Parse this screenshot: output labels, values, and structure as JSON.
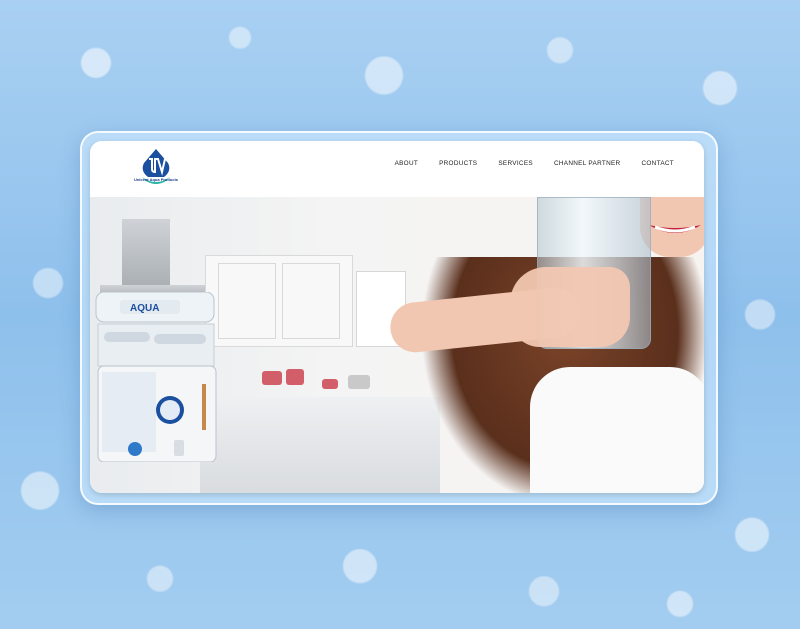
{
  "logo": {
    "name": "Unicent Aqua Products",
    "initials": "UA"
  },
  "nav": {
    "items": [
      "ABOUT",
      "PRODUCTS",
      "SERVICES",
      "CHANNEL PARTNER",
      "CONTACT"
    ]
  },
  "hero": {
    "purifier_label": "AQUA"
  },
  "colors": {
    "background": "#9ec8ef",
    "brand": "#1b4fa0",
    "accent": "#2bb6a8"
  }
}
